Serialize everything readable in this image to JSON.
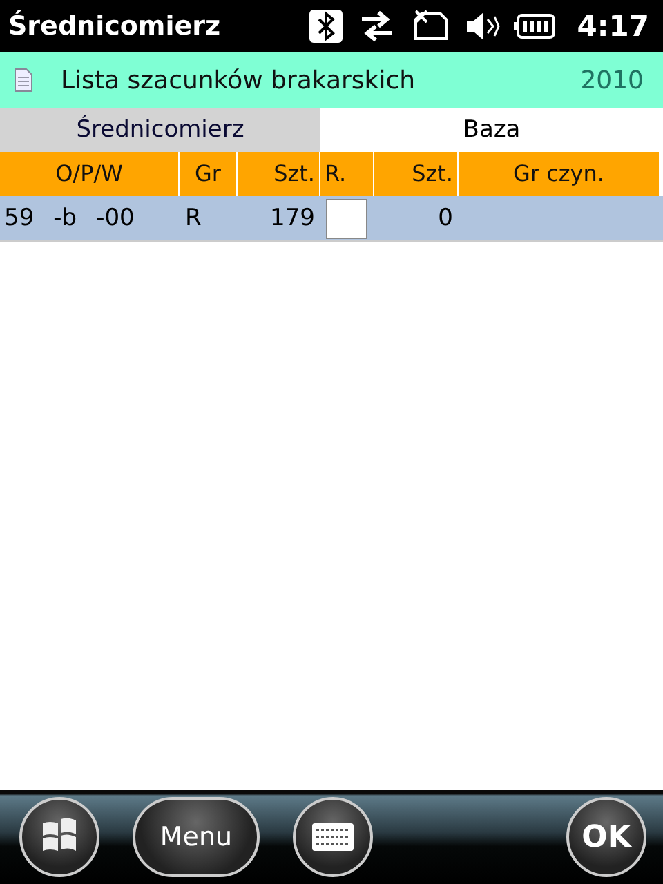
{
  "status_bar": {
    "title": "Średnicomierz",
    "time": "4:17"
  },
  "header": {
    "title": "Lista szacunków brakarskich",
    "year": "2010"
  },
  "tabs": [
    {
      "label": "Średnicomierz",
      "selected": false
    },
    {
      "label": "Baza",
      "selected": true
    }
  ],
  "table": {
    "columns": [
      "O/P/W",
      "Gr",
      "Szt.",
      "R.",
      "Szt.",
      "Gr czyn."
    ],
    "rows": [
      {
        "o_p_w": [
          "59",
          "-b",
          "-00"
        ],
        "gr": "R",
        "szt": "179",
        "r_checked": false,
        "szt_2": "0",
        "selected": true
      }
    ]
  },
  "softkeys": {
    "menu": "Menu",
    "ok": "OK"
  }
}
